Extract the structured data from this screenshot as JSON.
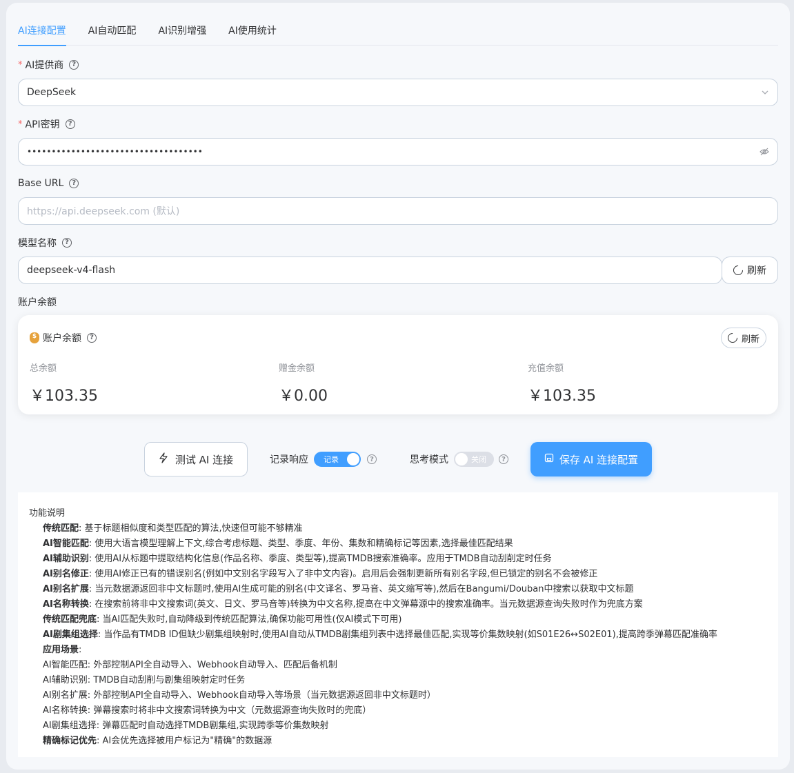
{
  "tabs": [
    "AI连接配置",
    "AI自动匹配",
    "AI识别增强",
    "AI使用统计"
  ],
  "provider": {
    "label": "AI提供商",
    "value": "DeepSeek"
  },
  "api_key": {
    "label": "API密钥",
    "value": "••••••••••••••••••••••••••••••••••••"
  },
  "base_url": {
    "label": "Base URL",
    "placeholder": "https://api.deepseek.com (默认)"
  },
  "model": {
    "label": "模型名称",
    "value": "deepseek-v4-flash",
    "refresh_label": "刷新"
  },
  "balance_section_label": "账户余额",
  "balance": {
    "title": "账户余额",
    "refresh_label": "刷新",
    "total_label": "总余额",
    "total_value": "￥103.35",
    "gift_label": "赠金余额",
    "gift_value": "￥0.00",
    "topup_label": "充值余额",
    "topup_value": "￥103.35"
  },
  "actions": {
    "test_label": "测试 AI 连接",
    "log_label": "记录响应",
    "log_switch": "记录",
    "think_label": "思考模式",
    "think_switch": "关闭",
    "save_label": "保存 AI 连接配置"
  },
  "info": {
    "title": "功能说明",
    "lines": [
      {
        "b": "传统匹配",
        "t": ": 基于标题相似度和类型匹配的算法,快速但可能不够精准"
      },
      {
        "b": "AI智能匹配",
        "t": ": 使用大语言模型理解上下文,综合考虑标题、类型、季度、年份、集数和精确标记等因素,选择最佳匹配结果"
      },
      {
        "b": "AI辅助识别",
        "t": ": 使用AI从标题中提取结构化信息(作品名称、季度、类型等),提高TMDB搜索准确率。应用于TMDB自动刮削定时任务"
      },
      {
        "b": "AI别名修正",
        "t": ": 使用AI修正已有的错误别名(例如中文别名字段写入了非中文内容)。启用后会强制更新所有别名字段,但已锁定的别名不会被修正"
      },
      {
        "b": "AI别名扩展",
        "t": ": 当元数据源返回非中文标题时,使用AI生成可能的别名(中文译名、罗马音、英文缩写等),然后在Bangumi/Douban中搜索以获取中文标题"
      },
      {
        "b": "AI名称转换",
        "t": ": 在搜索前将非中文搜索词(英文、日文、罗马音等)转换为中文名称,提高在中文弹幕源中的搜索准确率。当元数据源查询失败时作为兜底方案"
      },
      {
        "b": "传统匹配兜底",
        "t": ": 当AI匹配失败时,自动降级到传统匹配算法,确保功能可用性(仅AI模式下可用)"
      },
      {
        "b": "AI剧集组选择",
        "t": ": 当作品有TMDB ID但缺少剧集组映射时,使用AI自动从TMDB剧集组列表中选择最佳匹配,实现等价集数映射(如S01E26↔S02E01),提高跨季弹幕匹配准确率"
      },
      {
        "b": "应用场景",
        "t": ":"
      },
      {
        "b": "",
        "t": "AI智能匹配: 外部控制API全自动导入、Webhook自动导入、匹配后备机制"
      },
      {
        "b": "",
        "t": "AI辅助识别: TMDB自动刮削与剧集组映射定时任务"
      },
      {
        "b": "",
        "t": "AI别名扩展: 外部控制API全自动导入、Webhook自动导入等场景（当元数据源返回非中文标题时）"
      },
      {
        "b": "",
        "t": "AI名称转换: 弹幕搜索时将非中文搜索词转换为中文（元数据源查询失败时的兜底）"
      },
      {
        "b": "",
        "t": "AI剧集组选择: 弹幕匹配时自动选择TMDB剧集组,实现跨季等价集数映射"
      },
      {
        "b": "精确标记优先",
        "t": ": AI会优先选择被用户标记为\"精确\"的数据源"
      }
    ]
  }
}
